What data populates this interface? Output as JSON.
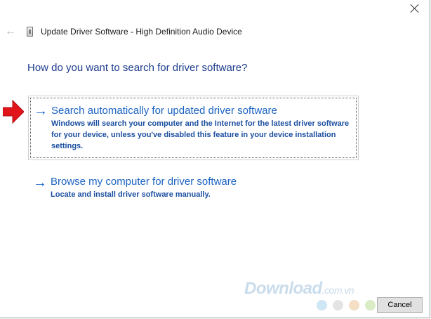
{
  "window": {
    "title": "Update Driver Software - High Definition Audio Device",
    "heading": "How do you want to search for driver software?"
  },
  "options": [
    {
      "title": "Search automatically for updated driver software",
      "description": "Windows will search your computer and the Internet for the latest driver software for your device, unless you've disabled this feature in your device installation settings.",
      "focused": true
    },
    {
      "title": "Browse my computer for driver software",
      "description": "Locate and install driver software manually.",
      "focused": false
    }
  ],
  "footer": {
    "cancel_label": "Cancel"
  },
  "watermark": {
    "main": "Download",
    "suffix": ".com.vn"
  },
  "colors": {
    "link_blue": "#1b63c3",
    "heading_blue": "#1c3c8c",
    "annotation_red": "#e2141b",
    "dots": [
      "#cfe6f4",
      "#e4e4e4",
      "#f4dfc6",
      "#d9ecc5",
      "#f3c9c4",
      "#cfcfcf"
    ]
  },
  "icons": {
    "close": "close-icon",
    "back": "back-arrow-icon",
    "device": "audio-device-icon",
    "option_arrow": "right-arrow-icon",
    "annotation": "red-pointer-arrow-icon"
  }
}
